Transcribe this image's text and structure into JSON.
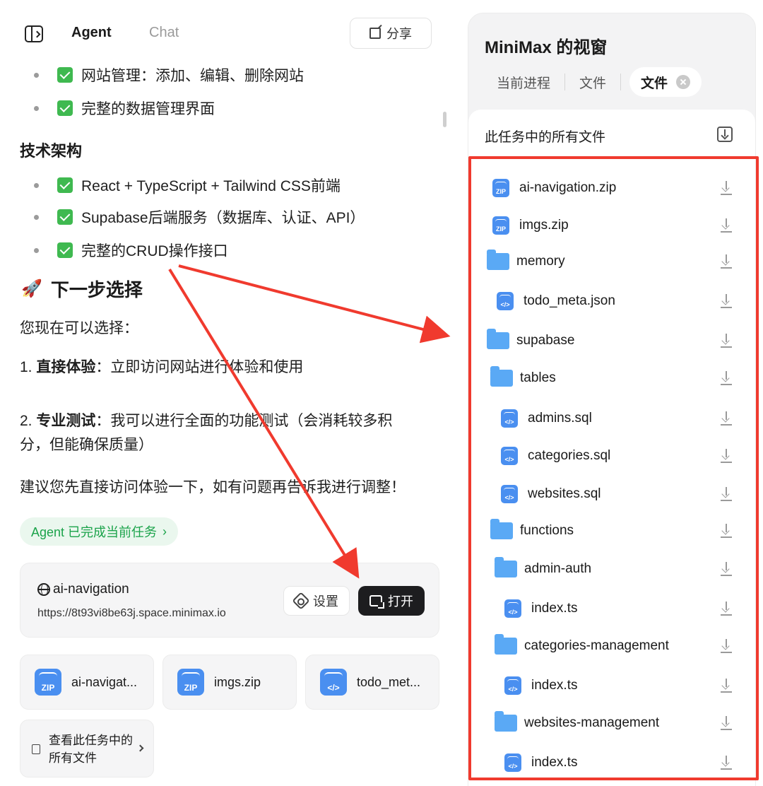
{
  "header": {
    "tabs": [
      "Agent",
      "Chat"
    ],
    "share_label": "分享"
  },
  "chat": {
    "bullets_top": [
      "网站管理：添加、编辑、删除网站",
      "完整的数据管理界面"
    ],
    "tech_heading": "技术架构",
    "tech_bullets": [
      "React + TypeScript + Tailwind CSS前端",
      "Supabase后端服务（数据库、认证、API）",
      "完整的CRUD操作接口"
    ],
    "next_heading": "下一步选择",
    "next_icon": "rocket",
    "intro": "您现在可以选择：",
    "option1_num": "1.",
    "option1_bold": "直接体验",
    "option1_text": "：立即访问网站进行体验和使用",
    "option2_num": "2.",
    "option2_bold": "专业测试",
    "option2_text_line1": "：我可以进行全面的功能测试（会消耗较多积",
    "option2_text_line2": "分，但能确保质量）",
    "suggestion": "建议您先直接访问体验一下，如有问题再告诉我进行调整！",
    "status_pill": "Agent 已完成当前任务",
    "site": {
      "name": "ai-navigation",
      "url": "https://8t93vi8be63j.space.minimax.io",
      "settings_label": "设置",
      "open_label": "打开"
    },
    "file_chips": [
      {
        "label": "ai-navigat...",
        "icon": "ZIP"
      },
      {
        "label": "imgs.zip",
        "icon": "ZIP"
      },
      {
        "label": "todo_met...",
        "icon": "</>"
      }
    ],
    "view_all_label": "查看此任务中的所有文件"
  },
  "panel": {
    "title": "MiniMax 的视窗",
    "tabs": [
      "当前进程",
      "文件",
      "文件"
    ],
    "list_title": "此任务中的所有文件",
    "files": [
      {
        "name": "ai-navigation.zip",
        "type": "zip"
      },
      {
        "name": "imgs.zip",
        "type": "zip"
      },
      {
        "name": "memory",
        "type": "folder"
      },
      {
        "name": "todo_meta.json",
        "type": "code"
      },
      {
        "name": "supabase",
        "type": "folder"
      },
      {
        "name": "tables",
        "type": "folder"
      },
      {
        "name": "admins.sql",
        "type": "code"
      },
      {
        "name": "categories.sql",
        "type": "code"
      },
      {
        "name": "websites.sql",
        "type": "code"
      },
      {
        "name": "functions",
        "type": "folder"
      },
      {
        "name": "admin-auth",
        "type": "folder"
      },
      {
        "name": "index.ts",
        "type": "code"
      },
      {
        "name": "categories-management",
        "type": "folder"
      },
      {
        "name": "index.ts",
        "type": "code"
      },
      {
        "name": "websites-management",
        "type": "folder"
      },
      {
        "name": "index.ts",
        "type": "code"
      }
    ]
  },
  "colors": {
    "annotation_red": "#f03a2e",
    "check_green": "#3fb950",
    "file_blue": "#4a8ff0",
    "folder_blue": "#5aa9f5"
  }
}
